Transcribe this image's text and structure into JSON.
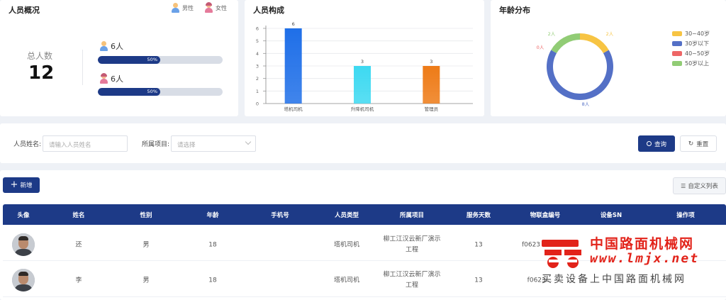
{
  "overview": {
    "title": "人员概况",
    "legend_male": "男性",
    "legend_female": "女性",
    "total_label": "总人数",
    "total_value": "12",
    "male_count": "6人",
    "male_pct": "50%",
    "male_fraction": 0.5,
    "female_count": "6人",
    "female_pct": "50%",
    "female_fraction": 0.5
  },
  "composition": {
    "title": "人员构成"
  },
  "age": {
    "title": "年龄分布",
    "legend": [
      {
        "label": "30~40岁",
        "color": "#f7c443"
      },
      {
        "label": "30岁以下",
        "color": "#5470c6"
      },
      {
        "label": "40~50岁",
        "color": "#ee6666"
      },
      {
        "label": "50岁以上",
        "color": "#91cc75"
      }
    ],
    "slice_labels": [
      "2人",
      "8人",
      "0人",
      "2人"
    ]
  },
  "chart_data": [
    {
      "type": "bar",
      "title": "人员构成",
      "categories": [
        "塔机司机",
        "升降机司机",
        "管理员"
      ],
      "values": [
        6,
        3,
        3
      ],
      "colors": [
        "#1f6fe8",
        "#3dd9f1",
        "#ee7b17"
      ],
      "ylim": [
        0,
        6
      ],
      "yticks": [
        "0",
        "1",
        "2",
        "3",
        "4",
        "5",
        "6"
      ],
      "grid": true
    },
    {
      "type": "pie",
      "title": "年龄分布",
      "categories": [
        "30~40岁",
        "30岁以下",
        "40~50岁",
        "50岁以上"
      ],
      "values": [
        2,
        8,
        0,
        2
      ],
      "colors": [
        "#f7c443",
        "#5470c6",
        "#ee6666",
        "#91cc75"
      ],
      "legend": "right"
    }
  ],
  "filter": {
    "name_label": "人员姓名:",
    "name_placeholder": "请输入人员姓名",
    "project_label": "所属项目:",
    "project_placeholder": "请选择",
    "search_label": "查询",
    "reset_label": "重置"
  },
  "toolbar": {
    "add_label": "新增",
    "custom_list_label": "自定义列表"
  },
  "table": {
    "headers": [
      "头像",
      "姓名",
      "性别",
      "年龄",
      "手机号",
      "人员类型",
      "所属项目",
      "服务天数",
      "物联盒编号",
      "设备SN",
      "操作项"
    ],
    "rows": [
      {
        "name": "还",
        "gender": "男",
        "age": "18",
        "phone": "",
        "type": "塔机司机",
        "project_line1": "柳工江汉云新厂演示",
        "project_line2": "工程",
        "days": "13",
        "box": "f0623",
        "sn": ""
      },
      {
        "name": "李",
        "gender": "男",
        "age": "18",
        "phone": "",
        "type": "塔机司机",
        "project_line1": "柳工江汉云新厂演示",
        "project_line2": "工程",
        "days": "13",
        "box": "f0623...",
        "sn": ""
      }
    ]
  },
  "watermark": {
    "cn": "中国路面机械网",
    "url": "www.lmjx.net",
    "slogan": "买卖设备上中国路面机械网"
  }
}
